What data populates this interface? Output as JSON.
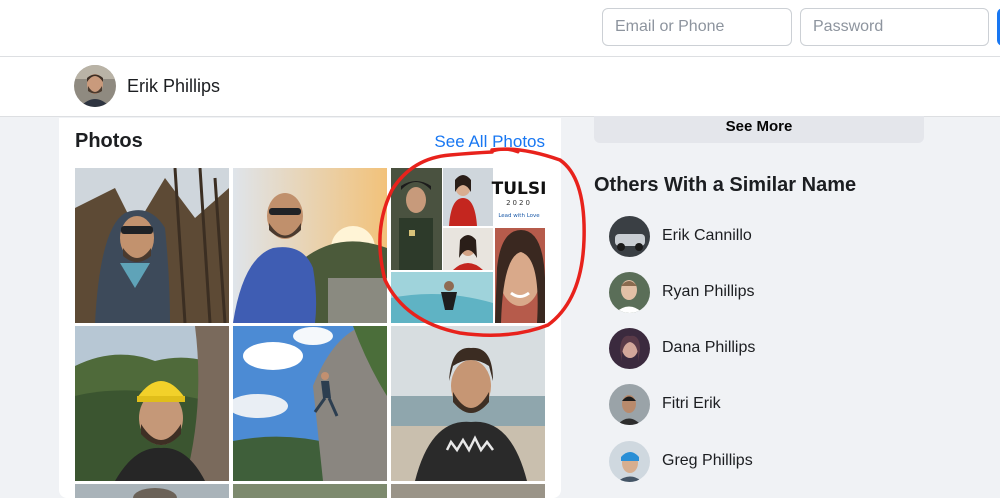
{
  "login": {
    "email_placeholder": "Email or Phone",
    "password_placeholder": "Password",
    "accent_color": "#1877f2"
  },
  "profile": {
    "name": "Erik Phillips"
  },
  "photos": {
    "title": "Photos",
    "see_all_label": "See All Photos",
    "collage": {
      "brand": "TULSI",
      "year": "2020",
      "tagline": "Lead with Love"
    }
  },
  "sidebar": {
    "see_more_label": "See More",
    "similar_title": "Others With a Similar Name",
    "people": [
      {
        "name": "Erik Cannillo"
      },
      {
        "name": "Ryan Phillips"
      },
      {
        "name": "Dana Phillips"
      },
      {
        "name": "Fitri Erik"
      },
      {
        "name": "Greg Phillips"
      }
    ]
  },
  "colors": {
    "background": "#f0f2f5",
    "card": "#ffffff",
    "link": "#1877f2",
    "annotation": "#e8221c"
  }
}
